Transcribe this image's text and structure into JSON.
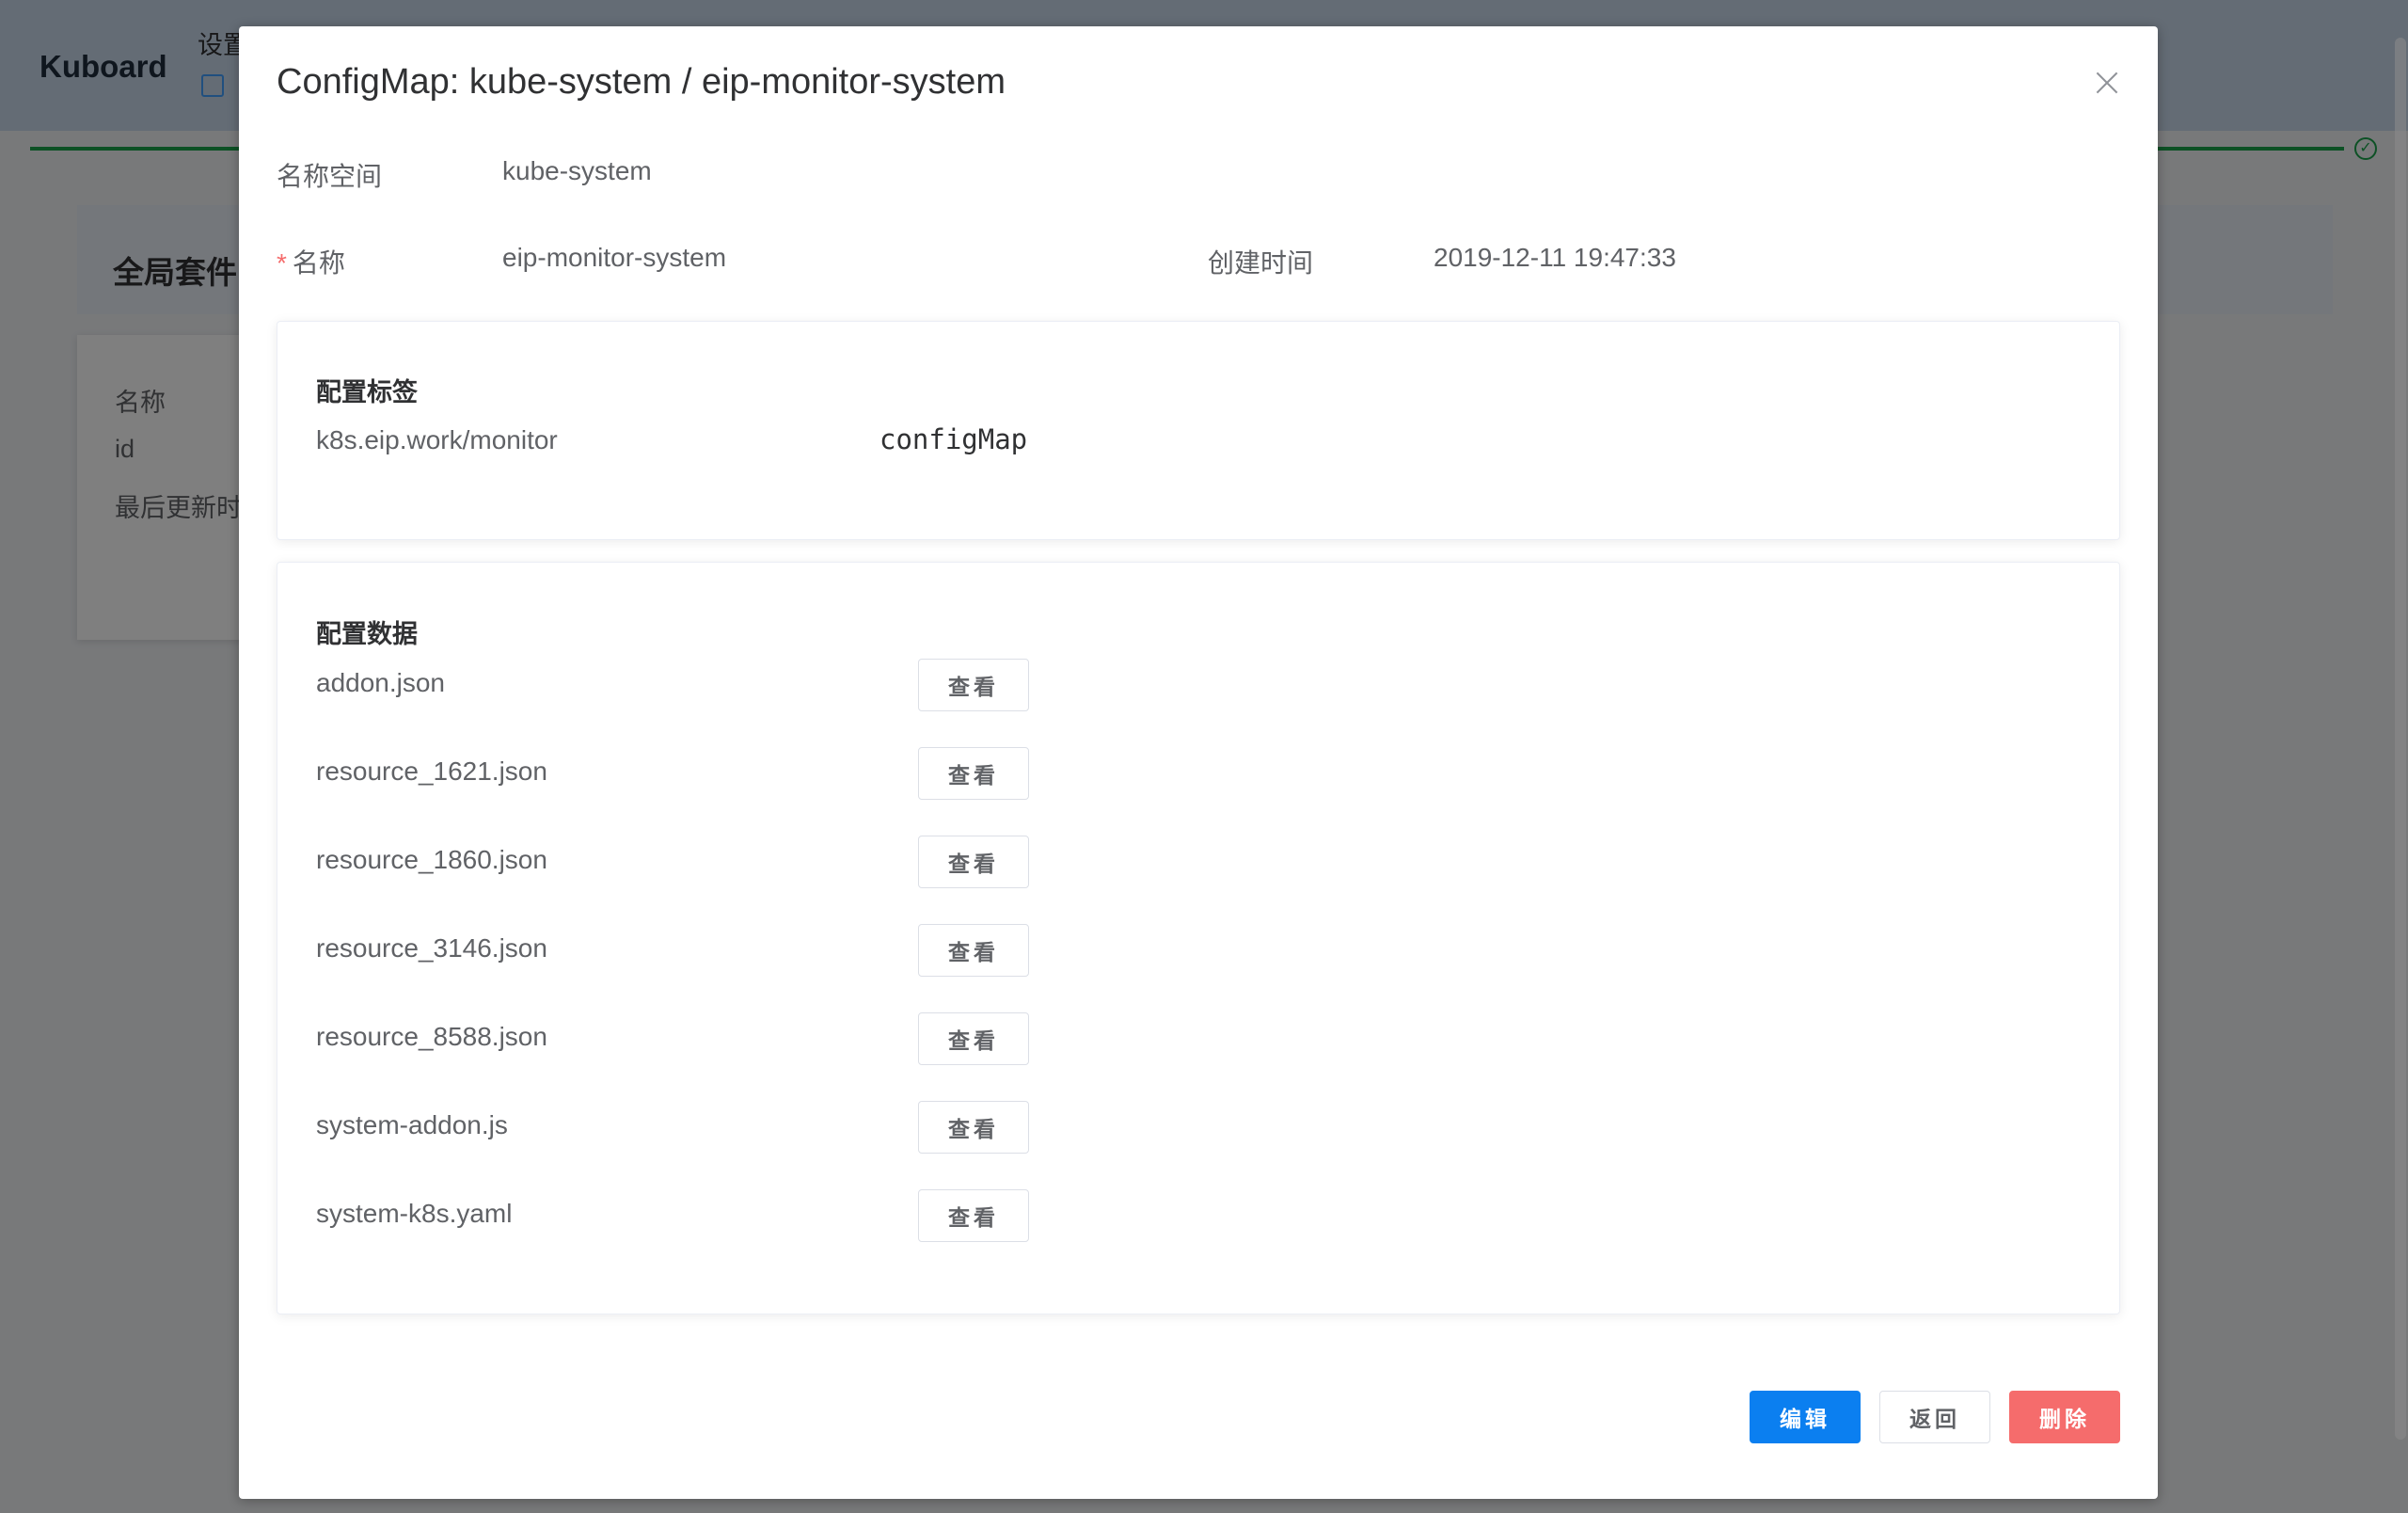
{
  "app": {
    "brand": "Kuboard",
    "header_settings": "设置",
    "section_title": "全局套件",
    "card_rows": [
      "名称",
      "id",
      "最后更新时"
    ]
  },
  "dialog": {
    "title": "ConfigMap: kube-system / eip-monitor-system",
    "namespace_label": "名称空间",
    "namespace_value": "kube-system",
    "name_required_mark": "*",
    "name_label": "名称",
    "name_value": "eip-monitor-system",
    "created_label": "创建时间",
    "created_value": "2019-12-11 19:47:33",
    "labels_panel": {
      "title": "配置标签",
      "labels": [
        {
          "key": "k8s.eip.work/monitor",
          "value": "configMap"
        }
      ]
    },
    "data_panel": {
      "title": "配置数据",
      "view_label": "查看",
      "items": [
        {
          "key": "addon.json"
        },
        {
          "key": "resource_1621.json"
        },
        {
          "key": "resource_1860.json"
        },
        {
          "key": "resource_3146.json"
        },
        {
          "key": "resource_8588.json"
        },
        {
          "key": "system-addon.js"
        },
        {
          "key": "system-k8s.yaml"
        }
      ]
    },
    "footer": {
      "edit_label": "编辑",
      "back_label": "返回",
      "delete_label": "删除"
    }
  },
  "colors": {
    "primary": "#0b7ff0",
    "danger": "#f56c6c",
    "success": "#1aa34a",
    "required_mark": "#f56c6c"
  }
}
